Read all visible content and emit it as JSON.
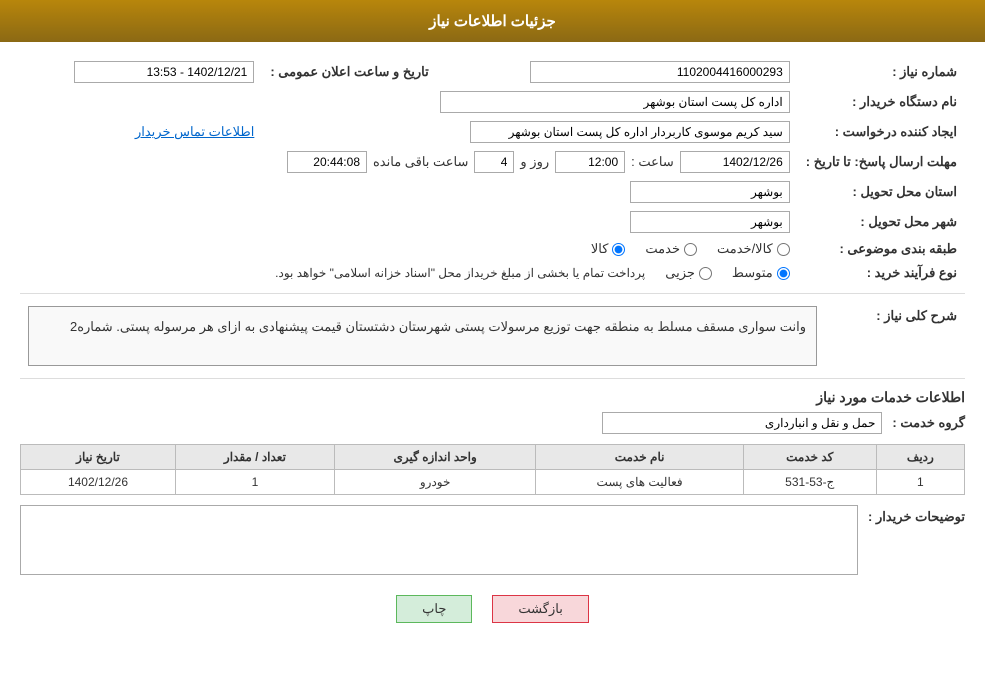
{
  "header": {
    "title": "جزئیات اطلاعات نیاز"
  },
  "fields": {
    "need_number_label": "شماره نیاز :",
    "need_number_value": "1102004416000293",
    "buyer_org_label": "نام دستگاه خریدار :",
    "buyer_org_value": "اداره کل پست استان بوشهر",
    "creator_label": "ایجاد کننده درخواست :",
    "creator_value": "سید کریم موسوی کاربردار اداره کل پست استان بوشهر",
    "contact_link": "اطلاعات تماس خریدار",
    "deadline_label": "مهلت ارسال پاسخ: تا تاریخ :",
    "deadline_date": "1402/12/26",
    "deadline_time_label": "ساعت :",
    "deadline_time": "12:00",
    "deadline_days_label": "روز و",
    "deadline_days": "4",
    "deadline_remain_label": "ساعت باقی مانده",
    "deadline_remain": "20:44:08",
    "province_label": "استان محل تحویل :",
    "province_value": "بوشهر",
    "city_label": "شهر محل تحویل :",
    "city_value": "بوشهر",
    "category_label": "طبقه بندی موضوعی :",
    "category_options": [
      "کالا",
      "خدمت",
      "کالا/خدمت"
    ],
    "category_selected": "کالا",
    "purchase_type_label": "نوع فرآیند خرید :",
    "purchase_type_options": [
      "جزیی",
      "متوسط"
    ],
    "purchase_type_selected": "متوسط",
    "purchase_note": "پرداخت تمام یا بخشی از مبلغ خریداز محل \"اسناد خزانه اسلامی\" خواهد بود.",
    "announcement_label": "تاریخ و ساعت اعلان عمومی :",
    "announcement_value": "1402/12/21 - 13:53",
    "need_desc_label": "شرح کلی نیاز :",
    "need_desc": "وانت سواری مسقف مسلط به منطقه جهت توزیع مرسولات پستی شهرستان دشتستان قیمت پیشنهادی به ازای هر مرسوله پستی. شماره2",
    "service_info_title": "اطلاعات خدمات مورد نیاز",
    "service_group_label": "گروه خدمت :",
    "service_group_value": "حمل و نقل و انبارداری",
    "table_headers": [
      "ردیف",
      "کد خدمت",
      "نام خدمت",
      "واحد اندازه گیری",
      "تعداد / مقدار",
      "تاریخ نیاز"
    ],
    "table_rows": [
      {
        "row": "1",
        "code": "ج-53-531",
        "name": "فعالیت های پست",
        "unit": "خودرو",
        "quantity": "1",
        "date": "1402/12/26"
      }
    ],
    "buyer_desc_label": "توضیحات خریدار :",
    "buyer_desc_value": ""
  },
  "buttons": {
    "print_label": "چاپ",
    "back_label": "بازگشت"
  }
}
